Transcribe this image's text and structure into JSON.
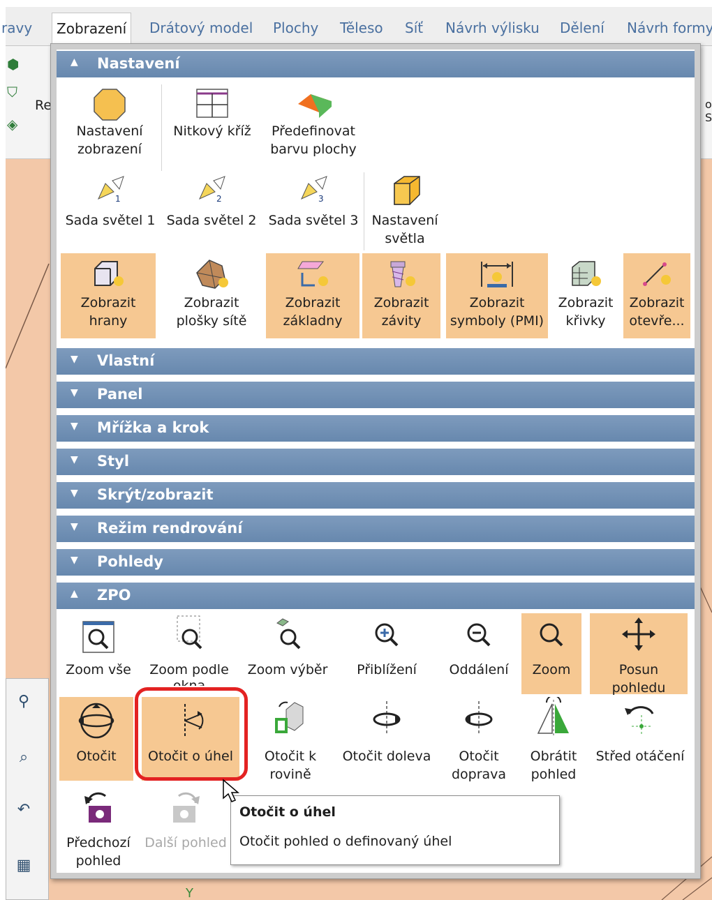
{
  "ribbon": {
    "tabs": [
      {
        "label": "ravy"
      },
      {
        "label": "Zobrazení",
        "active": true
      },
      {
        "label": "Drátový model"
      },
      {
        "label": "Plochy"
      },
      {
        "label": "Těleso"
      },
      {
        "label": "Síť"
      },
      {
        "label": "Návrh výlisku"
      },
      {
        "label": "Dělení"
      },
      {
        "label": "Návrh formy"
      }
    ]
  },
  "background": {
    "toolbar_label": "Re",
    "toolbar_right_label": "ov S"
  },
  "sections": {
    "nastaveni": {
      "title": "Nastavení",
      "buttons": [
        {
          "label": [
            "Nastavení",
            "zobrazení"
          ],
          "icon": "octagon-icon"
        },
        {
          "label": [
            "Nitkový kříž"
          ],
          "icon": "crosshair-icon"
        },
        {
          "label": [
            "Předefinovat",
            "barvu plochy"
          ],
          "icon": "face-color-icon"
        },
        {
          "label": [
            "Sada světel 1"
          ],
          "icon": "light-set-1-icon"
        },
        {
          "label": [
            "Sada světel 2"
          ],
          "icon": "light-set-2-icon"
        },
        {
          "label": [
            "Sada světel 3"
          ],
          "icon": "light-set-3-icon"
        },
        {
          "label": [
            "Nastavení",
            "světla"
          ],
          "icon": "light-settings-icon"
        },
        {
          "label": [
            "Zobrazit",
            "hrany"
          ],
          "icon": "show-edges-icon",
          "active": true
        },
        {
          "label": [
            "Zobrazit",
            "plošky sítě"
          ],
          "icon": "show-mesh-icon",
          "active": false
        },
        {
          "label": [
            "Zobrazit",
            "základny"
          ],
          "icon": "show-bases-icon",
          "active": true
        },
        {
          "label": [
            "Zobrazit",
            "závity"
          ],
          "icon": "show-threads-icon",
          "active": true
        },
        {
          "label": [
            "Zobrazit",
            "symboly (PMI)"
          ],
          "icon": "show-pmi-icon",
          "active": true
        },
        {
          "label": [
            "Zobrazit",
            "křivky"
          ],
          "icon": "show-curves-icon",
          "active": false
        },
        {
          "label": [
            "Zobrazit",
            "otevře..."
          ],
          "icon": "show-open-icon",
          "active": true
        }
      ]
    },
    "collapsed": [
      "Vlastní",
      "Panel",
      "Mřížka a krok",
      "Styl",
      "Skrýt/zobrazit",
      "Režim rendrování",
      "Pohledy"
    ],
    "zpo": {
      "title": "ZPO",
      "buttons": [
        {
          "label": [
            "Zoom vše"
          ],
          "icon": "zoom-all-icon"
        },
        {
          "label": [
            "Zoom podle",
            "okna"
          ],
          "icon": "zoom-window-icon"
        },
        {
          "label": [
            "Zoom výběr"
          ],
          "icon": "zoom-selection-icon"
        },
        {
          "label": [
            "Přiblížení"
          ],
          "icon": "zoom-in-icon"
        },
        {
          "label": [
            "Oddálení"
          ],
          "icon": "zoom-out-icon"
        },
        {
          "label": [
            "Zoom"
          ],
          "icon": "zoom-icon",
          "active": true
        },
        {
          "label": [
            "Posun",
            "pohledu"
          ],
          "icon": "pan-icon",
          "active": true
        },
        {
          "label": [
            "Otočit"
          ],
          "icon": "rotate-icon",
          "active": true
        },
        {
          "label": [
            "Otočit o úhel"
          ],
          "icon": "rotate-angle-icon",
          "active": true
        },
        {
          "label": [
            "Otočit k",
            "rovině"
          ],
          "icon": "rotate-to-plane-icon"
        },
        {
          "label": [
            "Otočit doleva"
          ],
          "icon": "rotate-left-icon"
        },
        {
          "label": [
            "Otočit",
            "doprava"
          ],
          "icon": "rotate-right-icon"
        },
        {
          "label": [
            "Obrátit",
            "pohled"
          ],
          "icon": "flip-view-icon"
        },
        {
          "label": [
            "Střed otáčení"
          ],
          "icon": "rotation-center-icon"
        },
        {
          "label": [
            "Předchozí",
            "pohled"
          ],
          "icon": "previous-view-icon"
        },
        {
          "label": [
            "Další pohled"
          ],
          "icon": "next-view-icon",
          "disabled": true
        }
      ]
    }
  },
  "tooltip": {
    "title": "Otočit o úhel",
    "description": "Otočit pohled o definovaný úhel"
  },
  "colors": {
    "section_header": "#6f8fb4",
    "active_button": "#f6c892",
    "highlight_ring": "#e32222",
    "canvas": "#f3c8a8"
  }
}
